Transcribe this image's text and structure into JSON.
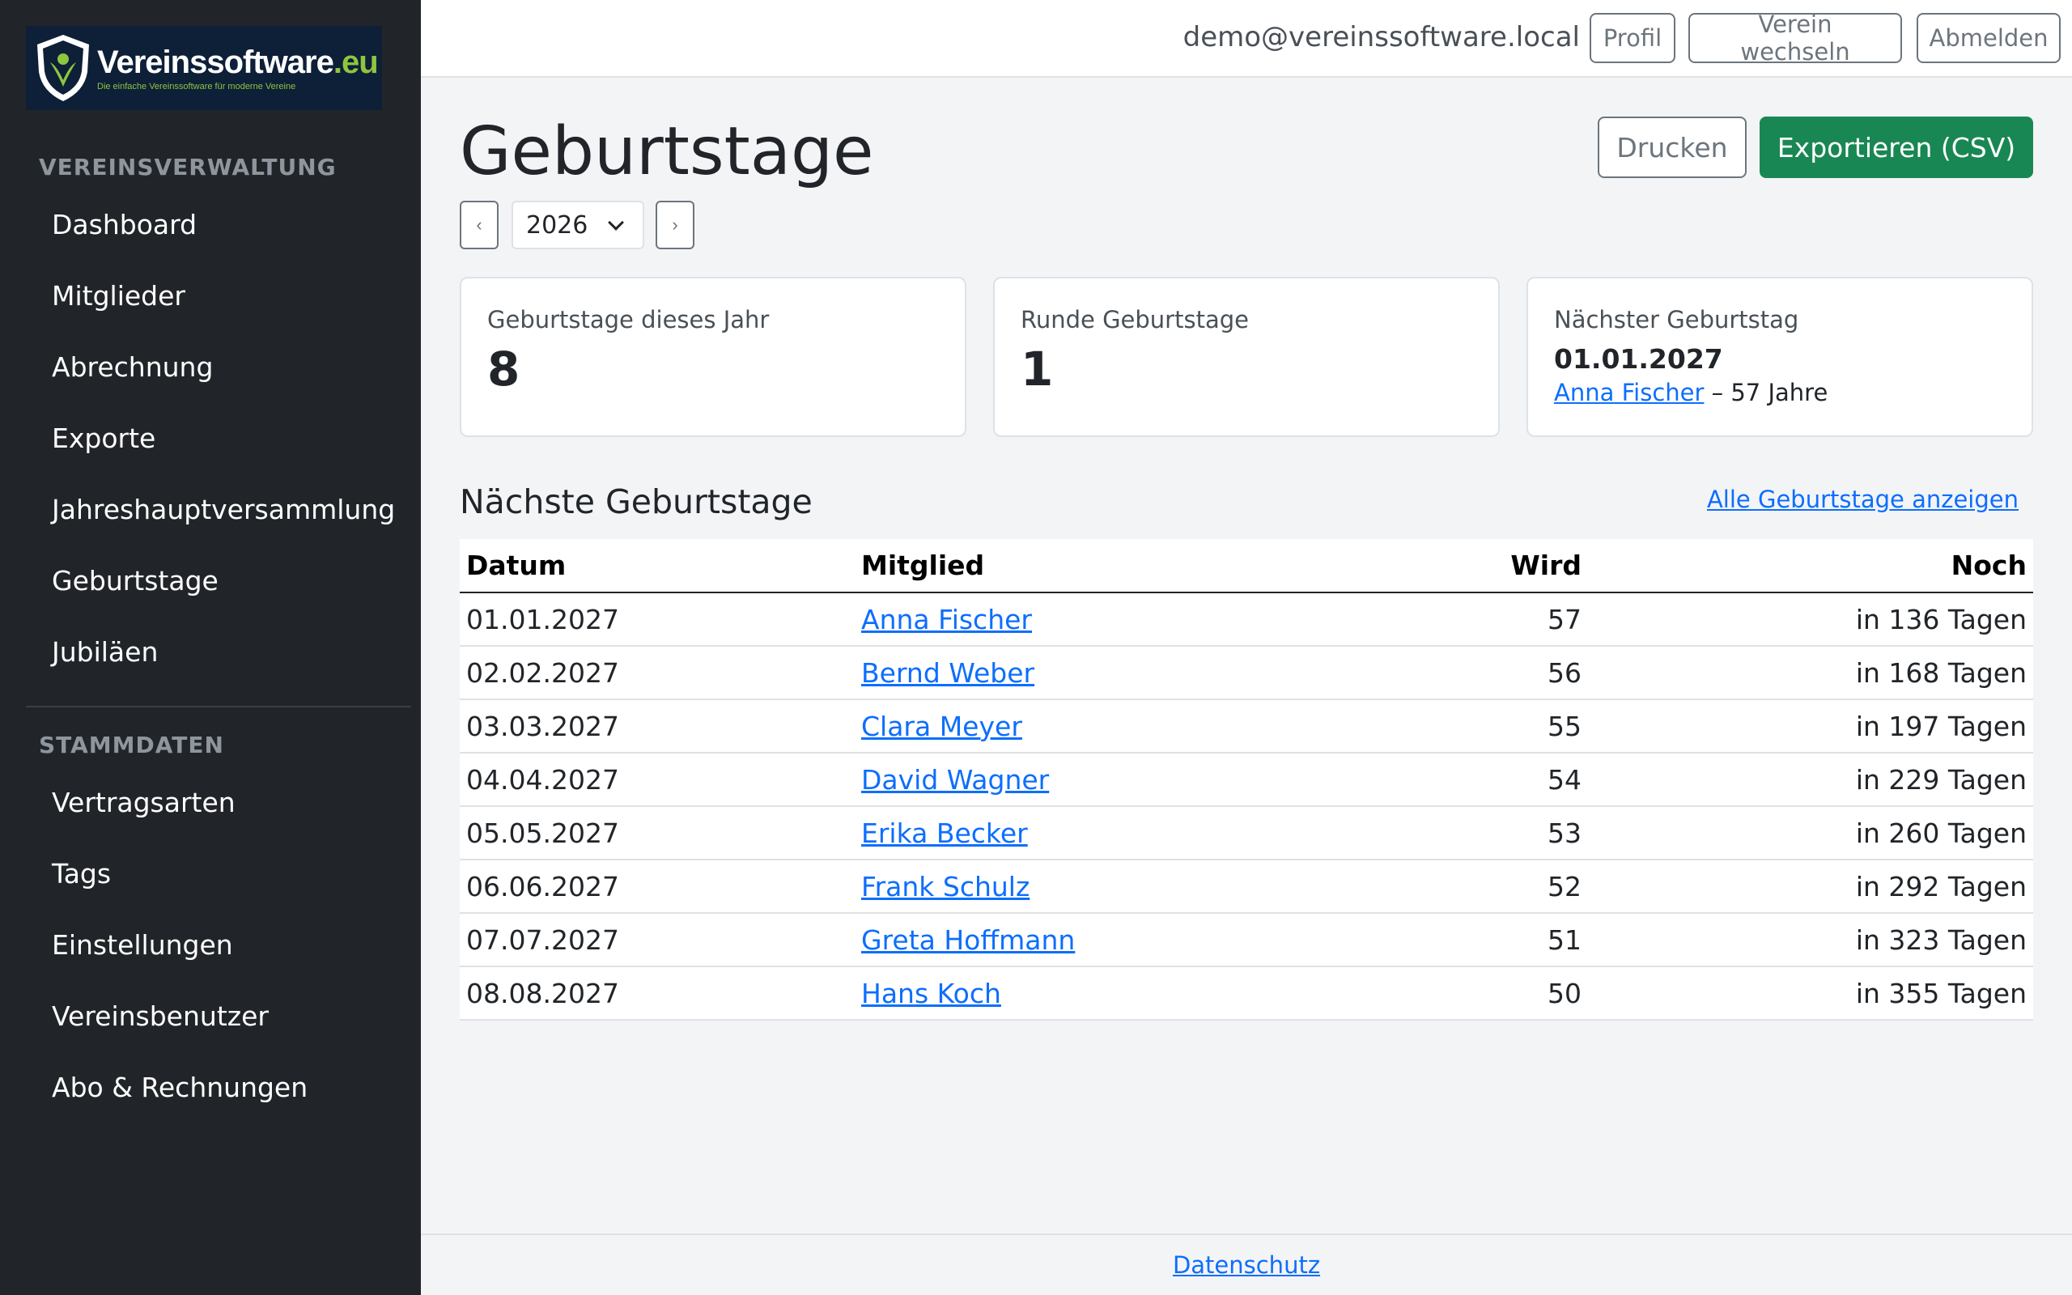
{
  "brand": {
    "title": "Vereinssoftware",
    "tld": ".eu",
    "tagline": "Die einfache Vereinssoftware für moderne Vereine"
  },
  "sidebar": {
    "sections": [
      {
        "heading": "VEREINSVERWALTUNG",
        "items": [
          {
            "label": "Dashboard"
          },
          {
            "label": "Mitglieder"
          },
          {
            "label": "Abrechnung"
          },
          {
            "label": "Exporte"
          },
          {
            "label": "Jahreshauptversammlung"
          },
          {
            "label": "Geburtstage"
          },
          {
            "label": "Jubiläen"
          }
        ]
      },
      {
        "heading": "STAMMDATEN",
        "items": [
          {
            "label": "Vertragsarten"
          },
          {
            "label": "Tags"
          },
          {
            "label": "Einstellungen"
          },
          {
            "label": "Vereinsbenutzer"
          },
          {
            "label": "Abo & Rechnungen"
          }
        ]
      }
    ]
  },
  "topbar": {
    "email": "demo@vereinssoftware.local",
    "profile_label": "Profil",
    "switch_label": "Verein wechseln",
    "logout_label": "Abmelden"
  },
  "page": {
    "title": "Geburtstage",
    "print_label": "Drucken",
    "export_label": "Exportieren (CSV)",
    "prev_label": "‹",
    "next_label": "›",
    "year": "2026"
  },
  "cards": {
    "this_year": {
      "label": "Geburtstage dieses Jahr",
      "value": "8"
    },
    "round": {
      "label": "Runde Geburtstage",
      "value": "1"
    },
    "next": {
      "label": "Nächster Geburtstag",
      "date": "01.01.2027",
      "name": "Anna Fischer",
      "suffix": " – 57 Jahre"
    }
  },
  "upcoming": {
    "title": "Nächste Geburtstage",
    "all_link": "Alle Geburtstage anzeigen",
    "columns": [
      "Datum",
      "Mitglied",
      "Wird",
      "Noch"
    ],
    "rows": [
      {
        "date": "01.01.2027",
        "name": "Anna Fischer",
        "age": "57",
        "remaining": "in 136 Tagen"
      },
      {
        "date": "02.02.2027",
        "name": "Bernd Weber",
        "age": "56",
        "remaining": "in 168 Tagen"
      },
      {
        "date": "03.03.2027",
        "name": "Clara Meyer",
        "age": "55",
        "remaining": "in 197 Tagen"
      },
      {
        "date": "04.04.2027",
        "name": "David Wagner",
        "age": "54",
        "remaining": "in 229 Tagen"
      },
      {
        "date": "05.05.2027",
        "name": "Erika Becker",
        "age": "53",
        "remaining": "in 260 Tagen"
      },
      {
        "date": "06.06.2027",
        "name": "Frank Schulz",
        "age": "52",
        "remaining": "in 292 Tagen"
      },
      {
        "date": "07.07.2027",
        "name": "Greta Hoffmann",
        "age": "51",
        "remaining": "in 323 Tagen"
      },
      {
        "date": "08.08.2027",
        "name": "Hans Koch",
        "age": "50",
        "remaining": "in 355 Tagen"
      }
    ]
  },
  "footer": {
    "privacy_label": "Datenschutz"
  },
  "colors": {
    "sidebar_bg": "#212529",
    "accent_green": "#198754",
    "link_blue": "#0d6efd",
    "brand_green": "#8dc63f"
  }
}
